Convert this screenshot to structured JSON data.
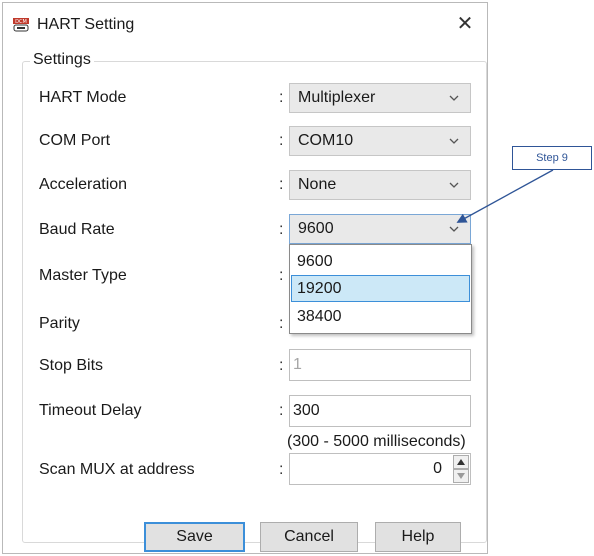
{
  "window": {
    "title": "HART Setting",
    "close_symbol": "✕",
    "icon": "dcm-device-icon"
  },
  "group": {
    "legend": "Settings"
  },
  "fields": {
    "hart_mode": {
      "label": "HART Mode",
      "colon": ":",
      "value": "Multiplexer"
    },
    "com_port": {
      "label": "COM Port",
      "colon": ":",
      "value": "COM10"
    },
    "acceleration": {
      "label": "Acceleration",
      "colon": ":",
      "value": "None"
    },
    "baud_rate": {
      "label": "Baud Rate",
      "colon": ":",
      "value": "9600"
    },
    "master_type": {
      "label": "Master Type",
      "colon": ":"
    },
    "parity": {
      "label": "Parity",
      "colon": ":"
    },
    "stop_bits": {
      "label": "Stop Bits",
      "colon": ":",
      "value": "1"
    },
    "timeout_delay": {
      "label": "Timeout Delay",
      "colon": ":",
      "value": "300",
      "hint": "(300 - 5000 milliseconds)"
    },
    "scan_mux": {
      "label": "Scan MUX at address",
      "colon": ":",
      "value": "0"
    }
  },
  "baud_dropdown": {
    "options": [
      "9600",
      "19200",
      "38400"
    ],
    "highlighted": "19200"
  },
  "buttons": {
    "save": "Save",
    "cancel": "Cancel",
    "help": "Help"
  },
  "annotation": {
    "label": "Step 9",
    "color": "#2f5597"
  },
  "colors": {
    "accent": "#3c8fd9",
    "highlight": "#cce8f7",
    "combo_bg": "#e9e9e9"
  }
}
